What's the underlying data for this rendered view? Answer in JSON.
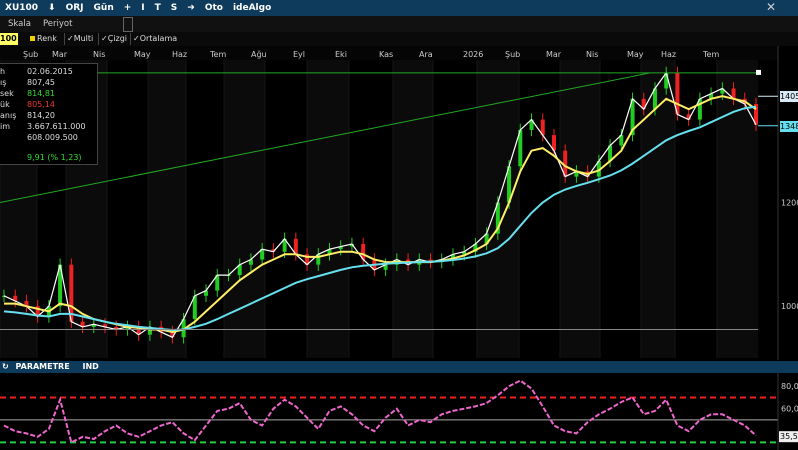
{
  "toolbar": {
    "symbol": "XU100",
    "items": [
      "⬇",
      "ORJ",
      "Gün",
      "+",
      "I",
      "T",
      "S",
      "➜",
      "Oto",
      "ideAlgo"
    ],
    "close": "✕"
  },
  "subbar": {
    "scale": "Skala",
    "period": "Periyot"
  },
  "options": {
    "symbol_short": "100",
    "renk": "Renk",
    "multi": "✓Multi",
    "cizgi": "✓Çizgi",
    "ortalama": "✓Ortalama"
  },
  "infobox": {
    "rows": [
      {
        "label": "h",
        "value": "02.06.2015",
        "color": "#dddddd"
      },
      {
        "label": "ış",
        "value": "807,45",
        "color": "#dddddd"
      },
      {
        "label": "sek",
        "value": "814,81",
        "color": "#33dd33"
      },
      {
        "label": "ük",
        "value": "805,14",
        "color": "#ee3333"
      },
      {
        "label": "anış",
        "value": "814,20",
        "color": "#dddddd"
      },
      {
        "label": "im",
        "value": "3.667.611.000",
        "color": "#dddddd"
      },
      {
        "label": "",
        "value": "608.009.500",
        "color": "#dddddd"
      },
      {
        "label": "",
        "value": "9,91 (% 1,23)",
        "color": "#33dd33"
      }
    ]
  },
  "indicator_panel": {
    "refresh_icon": "↻",
    "label1": "PARAMETRE",
    "label2": "IND"
  },
  "colors": {
    "up": "#22cc22",
    "down": "#ee2222",
    "ma_fast": "#ffffff",
    "ma_mid": "#ffee66",
    "ma_slow": "#66e0ee",
    "trend": "#22aa22",
    "rsi": "#ee66cc",
    "rsi_high": "#ee2222",
    "rsi_low": "#22cc44"
  },
  "chart_data": [
    {
      "type": "line",
      "title": "XU100",
      "x_ticks": [
        "Şub",
        "Mar",
        "Nis",
        "May",
        "Haz",
        "Tem",
        "Ağu",
        "Eyl",
        "Eki",
        "Kas",
        "Ara",
        "2026",
        "Şub",
        "Mar",
        "Nis",
        "May",
        "Haz",
        "Tem"
      ],
      "y_ticks": [
        "1000",
        "1200",
        "1405",
        "1348"
      ],
      "ylim": [
        900,
        1500
      ],
      "price_tags": [
        {
          "text": "1405",
          "value": 1405,
          "color": "#d8eaf5"
        },
        {
          "text": "1348",
          "value": 1348,
          "color": "#66e0ee"
        }
      ],
      "series": [
        {
          "values": [
            1020,
            1010,
            1000,
            980,
            1000,
            1080,
            970,
            960,
            965,
            960,
            955,
            960,
            945,
            960,
            950,
            940,
            975,
            1020,
            1030,
            1060,
            1060,
            1080,
            1090,
            1110,
            1105,
            1130,
            1100,
            1080,
            1100,
            1110,
            1115,
            1120,
            1090,
            1070,
            1080,
            1090,
            1080,
            1090,
            1085,
            1090,
            1100,
            1105,
            1120,
            1140,
            1200,
            1270,
            1340,
            1360,
            1330,
            1300,
            1250,
            1260,
            1250,
            1280,
            1310,
            1330,
            1400,
            1380,
            1420,
            1450,
            1370,
            1360,
            1400,
            1410,
            1420,
            1400,
            1390,
            1350
          ]
        },
        {
          "values": [
            1005,
            1005,
            1000,
            995,
            990,
            1005,
            1000,
            985,
            975,
            970,
            965,
            960,
            958,
            955,
            955,
            950,
            955,
            970,
            990,
            1010,
            1030,
            1050,
            1065,
            1080,
            1090,
            1100,
            1100,
            1095,
            1095,
            1100,
            1105,
            1105,
            1100,
            1090,
            1085,
            1085,
            1085,
            1085,
            1085,
            1088,
            1092,
            1098,
            1108,
            1120,
            1150,
            1200,
            1260,
            1300,
            1305,
            1290,
            1270,
            1260,
            1255,
            1262,
            1280,
            1300,
            1340,
            1360,
            1380,
            1400,
            1390,
            1380,
            1390,
            1400,
            1405,
            1400,
            1395,
            1380
          ]
        },
        {
          "values": [
            990,
            988,
            985,
            982,
            980,
            985,
            985,
            980,
            975,
            970,
            966,
            963,
            960,
            958,
            956,
            954,
            955,
            960,
            966,
            975,
            985,
            995,
            1005,
            1015,
            1025,
            1035,
            1045,
            1052,
            1058,
            1064,
            1070,
            1075,
            1078,
            1080,
            1082,
            1083,
            1084,
            1085,
            1086,
            1087,
            1089,
            1092,
            1096,
            1102,
            1112,
            1130,
            1155,
            1180,
            1200,
            1215,
            1225,
            1232,
            1238,
            1245,
            1252,
            1262,
            1275,
            1290,
            1305,
            1320,
            1330,
            1338,
            1345,
            1355,
            1365,
            1375,
            1382,
            1385
          ]
        },
        {
          "values": [
            1200,
            1450
          ]
        }
      ]
    },
    {
      "type": "line",
      "title": "",
      "y_ticks": [
        "80,00",
        "60,00",
        "35,53"
      ],
      "ylim": [
        25,
        90
      ],
      "levels": [
        70,
        30
      ],
      "series": [
        {
          "values": [
            45,
            40,
            38,
            35,
            42,
            68,
            30,
            35,
            33,
            40,
            45,
            38,
            35,
            40,
            45,
            48,
            38,
            32,
            45,
            58,
            60,
            65,
            50,
            45,
            60,
            68,
            62,
            52,
            42,
            58,
            62,
            55,
            45,
            40,
            52,
            60,
            45,
            50,
            48,
            55,
            58,
            60,
            62,
            65,
            72,
            80,
            85,
            78,
            62,
            45,
            40,
            38,
            48,
            55,
            60,
            66,
            70,
            55,
            58,
            68,
            45,
            40,
            50,
            55,
            55,
            50,
            45,
            36
          ]
        }
      ]
    }
  ]
}
